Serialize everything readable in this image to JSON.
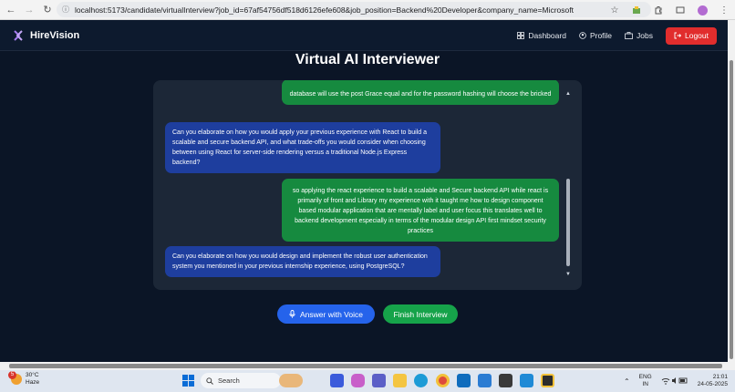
{
  "browser": {
    "url": "localhost:5173/candidate/virtualInterview?job_id=67af54756df518d6126efe608&job_position=Backend%20Developer&company_name=Microsoft"
  },
  "navbar": {
    "brand": "HireVision",
    "links": {
      "dashboard": "Dashboard",
      "profile": "Profile",
      "jobs": "Jobs"
    },
    "logout": "Logout"
  },
  "page": {
    "title": "Virtual AI Interviewer"
  },
  "chat": {
    "messages": [
      {
        "role": "user",
        "text": "database will use the post Grace equal and for the password hashing will choose the bricked"
      },
      {
        "role": "ai",
        "text": "Can you elaborate on how you would apply your previous experience with React to build a scalable and secure backend API, and what trade-offs you would consider when choosing between using React for server-side rendering versus a traditional Node.js Express backend?"
      },
      {
        "role": "user",
        "text": "so applying the react experience to build a scalable and Secure backend API while react is primarily of front and Library my experience with it taught me how to design component based modular application that are mentally label and user focus this translates well to backend development especially in terms of the modular design API first mindset security practices"
      },
      {
        "role": "ai",
        "text": "Can you elaborate on how you would design and implement the robust user authentication system you mentioned in your previous internship experience, using PostgreSQL?"
      }
    ]
  },
  "actions": {
    "voice": "Answer with Voice",
    "finish": "Finish Interview"
  },
  "taskbar": {
    "weather_badge": "5",
    "temperature": "30°C",
    "condition": "Haze",
    "search_placeholder": "Search",
    "lang_line1": "ENG",
    "lang_line2": "IN",
    "time": "21:01",
    "date": "24-05-2025"
  },
  "colors": {
    "background": "#0b1526",
    "panel": "#1c2737",
    "user_bubble": "#168a3f",
    "ai_bubble": "#1e3e9e",
    "logout": "#e12d2d",
    "voice_button": "#2563eb",
    "finish_button": "#16a34a"
  }
}
